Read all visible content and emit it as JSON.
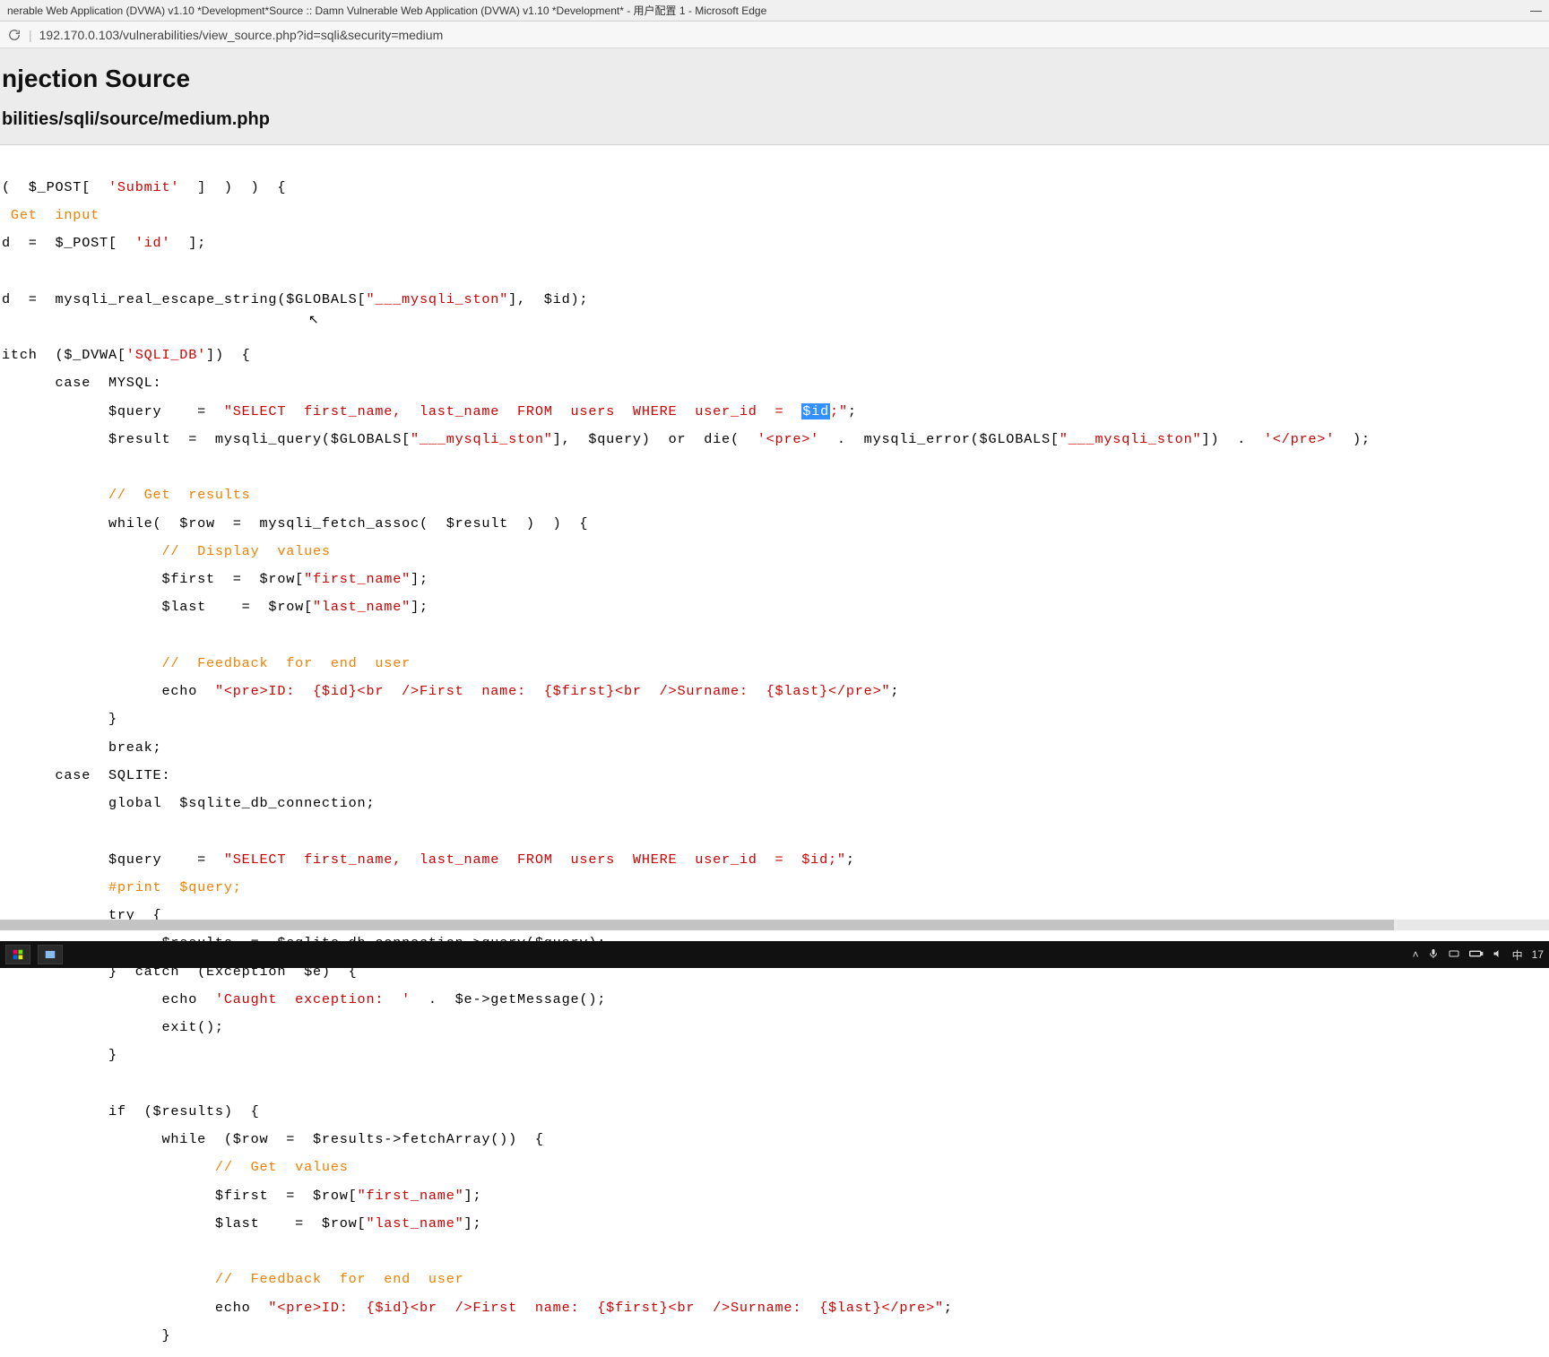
{
  "window": {
    "title": "nerable Web Application (DVWA) v1.10 *Development*Source :: Damn Vulnerable Web Application (DVWA) v1.10 *Development* - 用户配置 1 - Microsoft Edge",
    "minimize": "—"
  },
  "address": {
    "url": "192.170.0.103/vulnerabilities/view_source.php?id=sqli&security=medium"
  },
  "header": {
    "h1": "njection Source",
    "h2": "bilities/sqli/source/medium.php"
  },
  "code": {
    "l1a": "(  $_POST[  ",
    "l1b": "'Submit'",
    "l1c": "  ]  )  )  {",
    "l2": " Get  input",
    "l3a": "d  =  $_POST[  ",
    "l3b": "'id'",
    "l3c": "  ];",
    "l4a": "d  =  mysqli_real_escape_string($GLOBALS[",
    "l4b": "\"___mysqli_ston\"",
    "l4c": "],  $id);",
    "l5a": "itch  ($_DVWA[",
    "l5b": "'SQLI_DB'",
    "l5c": "])  {",
    "l6": "      case  MYSQL:",
    "l7a": "            $query    =  ",
    "l7b": "\"SELECT  first_name,  last_name  FROM  users  WHERE  user_id  =  ",
    "l7hl": "$id",
    "l7c": ";\"",
    "l7d": ";",
    "l8a": "            $result  =  mysqli_query($GLOBALS[",
    "l8b": "\"___mysqli_ston\"",
    "l8c": "],  $query)  ",
    "l8d": "or",
    "l8e": "  die(  ",
    "l8f": "'<pre>'",
    "l8g": "  .  mysqli_error($GLOBALS[",
    "l8h": "\"___mysqli_ston\"",
    "l8i": "])  .  ",
    "l8j": "'</pre>'",
    "l8k": "  );",
    "l9": "            //  Get  results",
    "l10": "            while(  $row  =  mysqli_fetch_assoc(  $result  )  )  {",
    "l11": "                  //  Display  values",
    "l12a": "                  $first  =  $row[",
    "l12b": "\"first_name\"",
    "l12c": "];",
    "l13a": "                  $last    =  $row[",
    "l13b": "\"last_name\"",
    "l13c": "];",
    "l14": "                  //  Feedback  for  end  user",
    "l15a": "                  echo  ",
    "l15b": "\"<pre>ID:  {$id}<br  />First  name:  {$first}<br  />Surname:  {$last}</pre>\"",
    "l15c": ";",
    "l16": "            }",
    "l17": "            break;",
    "l18": "      case  SQLITE:",
    "l19": "            global  $sqlite_db_connection;",
    "l20a": "            $query    =  ",
    "l20b": "\"SELECT  first_name,  last_name  FROM  users  WHERE  user_id  =  $id;\"",
    "l20c": ";",
    "l21": "            #print  $query;",
    "l22": "            try  {",
    "l23": "                  $results  =  $sqlite_db_connection->query($query);",
    "l24": "            }  catch  (Exception  $e)  {",
    "l25a": "                  echo  ",
    "l25b": "'Caught  exception:  '",
    "l25c": "  .  $e->getMessage();",
    "l26": "                  exit();",
    "l27": "            }",
    "l28": "            if  ($results)  {",
    "l29": "                  while  ($row  =  $results->fetchArray())  {",
    "l30": "                        //  Get  values",
    "l31a": "                        $first  =  $row[",
    "l31b": "\"first_name\"",
    "l31c": "];",
    "l32a": "                        $last    =  $row[",
    "l32b": "\"last_name\"",
    "l32c": "];",
    "l33": "                        //  Feedback  for  end  user",
    "l34a": "                        echo  ",
    "l34b": "\"<pre>ID:  {$id}<br  />First  name:  {$first}<br  />Surname:  {$last}</pre>\"",
    "l34c": ";",
    "l35": "                  }"
  },
  "taskbar": {
    "ime": "中",
    "time": "17"
  }
}
